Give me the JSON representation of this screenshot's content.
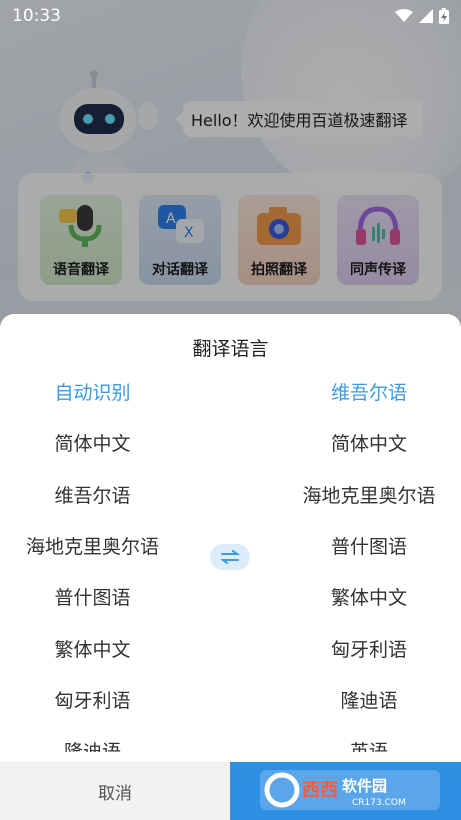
{
  "status_bar": {
    "time": "10:33",
    "icons": [
      "wifi-icon",
      "signal-icon",
      "battery-charging-icon"
    ]
  },
  "header": {
    "greeting": "Hello！欢迎使用百道极速翻译"
  },
  "features": [
    {
      "label": "语音翻译",
      "icon": "microphone-icon",
      "color": "#cfe8c9"
    },
    {
      "label": "对话翻译",
      "icon": "chat-translate-icon",
      "color": "#c9daf1"
    },
    {
      "label": "拍照翻译",
      "icon": "camera-icon",
      "color": "#f5d3c1"
    },
    {
      "label": "同声传译",
      "icon": "headphones-icon",
      "color": "#dccdf0"
    }
  ],
  "sheet": {
    "title": "翻译语言",
    "source_languages": [
      "自动识别",
      "简体中文",
      "维吾尔语",
      "海地克里奥尔语",
      "普什图语",
      "繁体中文",
      "匈牙利语",
      "隆迪语"
    ],
    "target_languages": [
      "维吾尔语",
      "简体中文",
      "海地克里奥尔语",
      "普什图语",
      "繁体中文",
      "匈牙利语",
      "隆迪语",
      "英语"
    ],
    "selected_source": "自动识别",
    "selected_target": "维吾尔语",
    "swap_icon": "swap-arrows-icon",
    "cancel_label": "取消",
    "watermark_text": "西西软件园",
    "watermark_url": "CR173.COM"
  },
  "colors": {
    "accent": "#3b9be0",
    "confirm_bg": "#2f8fe0",
    "swap_bg": "#dcecfb"
  }
}
